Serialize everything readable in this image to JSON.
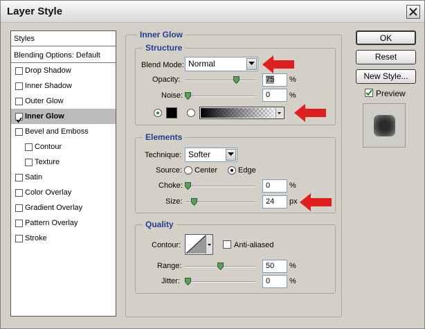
{
  "window": {
    "title": "Layer Style"
  },
  "left_panel": {
    "header": "Styles",
    "blending": "Blending Options: Default",
    "items": [
      {
        "label": "Drop Shadow",
        "checked": false
      },
      {
        "label": "Inner Shadow",
        "checked": false
      },
      {
        "label": "Outer Glow",
        "checked": false
      },
      {
        "label": "Inner Glow",
        "checked": true
      },
      {
        "label": "Bevel and Emboss",
        "checked": false
      },
      {
        "label": "Contour",
        "checked": false
      },
      {
        "label": "Texture",
        "checked": false
      },
      {
        "label": "Satin",
        "checked": false
      },
      {
        "label": "Color Overlay",
        "checked": false
      },
      {
        "label": "Gradient Overlay",
        "checked": false
      },
      {
        "label": "Pattern Overlay",
        "checked": false
      },
      {
        "label": "Stroke",
        "checked": false
      }
    ]
  },
  "inner_glow": {
    "title": "Inner Glow",
    "structure": {
      "title": "Structure",
      "blend_mode_label": "Blend Mode:",
      "blend_mode_value": "Normal",
      "opacity_label": "Opacity:",
      "opacity_value": "75",
      "opacity_unit": "%",
      "opacity_level": 0.75,
      "noise_label": "Noise:",
      "noise_value": "0",
      "noise_unit": "%",
      "noise_level": 0
    },
    "elements": {
      "title": "Elements",
      "technique_label": "Technique:",
      "technique_value": "Softer",
      "source_label": "Source:",
      "source_center": "Center",
      "source_edge": "Edge",
      "choke_label": "Choke:",
      "choke_value": "0",
      "choke_unit": "%",
      "choke_level": 0,
      "size_label": "Size:",
      "size_value": "24",
      "size_unit": "px",
      "size_level": 0.096
    },
    "quality": {
      "title": "Quality",
      "contour_label": "Contour:",
      "antialiased_label": "Anti-aliased",
      "range_label": "Range:",
      "range_value": "50",
      "range_unit": "%",
      "range_level": 0.5,
      "jitter_label": "Jitter:",
      "jitter_value": "0",
      "jitter_unit": "%",
      "jitter_level": 0
    }
  },
  "buttons": {
    "ok": "OK",
    "reset": "Reset",
    "new_style": "New Style...",
    "preview": "Preview"
  },
  "colors": {
    "arrow": "#e02020",
    "accent": "#1f3f8f",
    "slider_thumb": "#5aa05a"
  }
}
